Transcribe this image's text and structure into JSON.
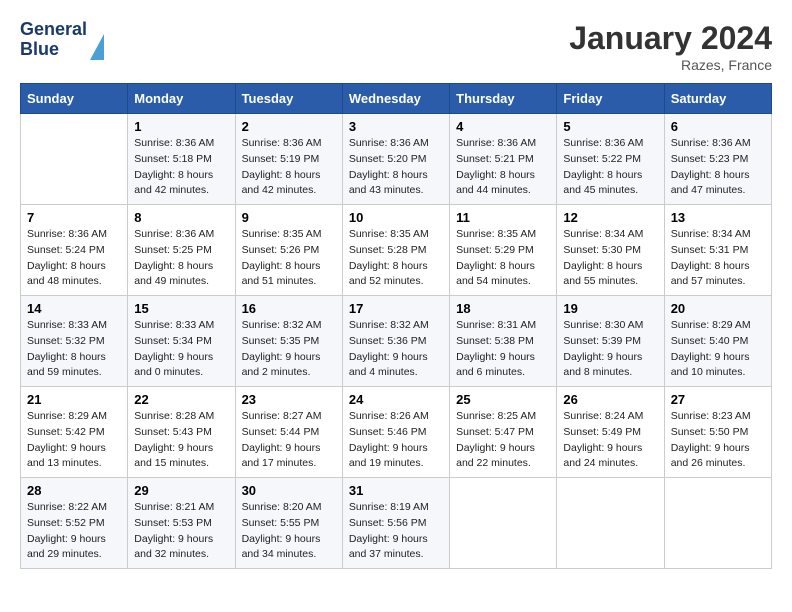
{
  "header": {
    "logo_line1": "General",
    "logo_line2": "Blue",
    "title": "January 2024",
    "subtitle": "Razes, France"
  },
  "days_header": [
    "Sunday",
    "Monday",
    "Tuesday",
    "Wednesday",
    "Thursday",
    "Friday",
    "Saturday"
  ],
  "weeks": [
    [
      {
        "num": "",
        "sunrise": "",
        "sunset": "",
        "daylight": ""
      },
      {
        "num": "1",
        "sunrise": "Sunrise: 8:36 AM",
        "sunset": "Sunset: 5:18 PM",
        "daylight": "Daylight: 8 hours and 42 minutes."
      },
      {
        "num": "2",
        "sunrise": "Sunrise: 8:36 AM",
        "sunset": "Sunset: 5:19 PM",
        "daylight": "Daylight: 8 hours and 42 minutes."
      },
      {
        "num": "3",
        "sunrise": "Sunrise: 8:36 AM",
        "sunset": "Sunset: 5:20 PM",
        "daylight": "Daylight: 8 hours and 43 minutes."
      },
      {
        "num": "4",
        "sunrise": "Sunrise: 8:36 AM",
        "sunset": "Sunset: 5:21 PM",
        "daylight": "Daylight: 8 hours and 44 minutes."
      },
      {
        "num": "5",
        "sunrise": "Sunrise: 8:36 AM",
        "sunset": "Sunset: 5:22 PM",
        "daylight": "Daylight: 8 hours and 45 minutes."
      },
      {
        "num": "6",
        "sunrise": "Sunrise: 8:36 AM",
        "sunset": "Sunset: 5:23 PM",
        "daylight": "Daylight: 8 hours and 47 minutes."
      }
    ],
    [
      {
        "num": "7",
        "sunrise": "Sunrise: 8:36 AM",
        "sunset": "Sunset: 5:24 PM",
        "daylight": "Daylight: 8 hours and 48 minutes."
      },
      {
        "num": "8",
        "sunrise": "Sunrise: 8:36 AM",
        "sunset": "Sunset: 5:25 PM",
        "daylight": "Daylight: 8 hours and 49 minutes."
      },
      {
        "num": "9",
        "sunrise": "Sunrise: 8:35 AM",
        "sunset": "Sunset: 5:26 PM",
        "daylight": "Daylight: 8 hours and 51 minutes."
      },
      {
        "num": "10",
        "sunrise": "Sunrise: 8:35 AM",
        "sunset": "Sunset: 5:28 PM",
        "daylight": "Daylight: 8 hours and 52 minutes."
      },
      {
        "num": "11",
        "sunrise": "Sunrise: 8:35 AM",
        "sunset": "Sunset: 5:29 PM",
        "daylight": "Daylight: 8 hours and 54 minutes."
      },
      {
        "num": "12",
        "sunrise": "Sunrise: 8:34 AM",
        "sunset": "Sunset: 5:30 PM",
        "daylight": "Daylight: 8 hours and 55 minutes."
      },
      {
        "num": "13",
        "sunrise": "Sunrise: 8:34 AM",
        "sunset": "Sunset: 5:31 PM",
        "daylight": "Daylight: 8 hours and 57 minutes."
      }
    ],
    [
      {
        "num": "14",
        "sunrise": "Sunrise: 8:33 AM",
        "sunset": "Sunset: 5:32 PM",
        "daylight": "Daylight: 8 hours and 59 minutes."
      },
      {
        "num": "15",
        "sunrise": "Sunrise: 8:33 AM",
        "sunset": "Sunset: 5:34 PM",
        "daylight": "Daylight: 9 hours and 0 minutes."
      },
      {
        "num": "16",
        "sunrise": "Sunrise: 8:32 AM",
        "sunset": "Sunset: 5:35 PM",
        "daylight": "Daylight: 9 hours and 2 minutes."
      },
      {
        "num": "17",
        "sunrise": "Sunrise: 8:32 AM",
        "sunset": "Sunset: 5:36 PM",
        "daylight": "Daylight: 9 hours and 4 minutes."
      },
      {
        "num": "18",
        "sunrise": "Sunrise: 8:31 AM",
        "sunset": "Sunset: 5:38 PM",
        "daylight": "Daylight: 9 hours and 6 minutes."
      },
      {
        "num": "19",
        "sunrise": "Sunrise: 8:30 AM",
        "sunset": "Sunset: 5:39 PM",
        "daylight": "Daylight: 9 hours and 8 minutes."
      },
      {
        "num": "20",
        "sunrise": "Sunrise: 8:29 AM",
        "sunset": "Sunset: 5:40 PM",
        "daylight": "Daylight: 9 hours and 10 minutes."
      }
    ],
    [
      {
        "num": "21",
        "sunrise": "Sunrise: 8:29 AM",
        "sunset": "Sunset: 5:42 PM",
        "daylight": "Daylight: 9 hours and 13 minutes."
      },
      {
        "num": "22",
        "sunrise": "Sunrise: 8:28 AM",
        "sunset": "Sunset: 5:43 PM",
        "daylight": "Daylight: 9 hours and 15 minutes."
      },
      {
        "num": "23",
        "sunrise": "Sunrise: 8:27 AM",
        "sunset": "Sunset: 5:44 PM",
        "daylight": "Daylight: 9 hours and 17 minutes."
      },
      {
        "num": "24",
        "sunrise": "Sunrise: 8:26 AM",
        "sunset": "Sunset: 5:46 PM",
        "daylight": "Daylight: 9 hours and 19 minutes."
      },
      {
        "num": "25",
        "sunrise": "Sunrise: 8:25 AM",
        "sunset": "Sunset: 5:47 PM",
        "daylight": "Daylight: 9 hours and 22 minutes."
      },
      {
        "num": "26",
        "sunrise": "Sunrise: 8:24 AM",
        "sunset": "Sunset: 5:49 PM",
        "daylight": "Daylight: 9 hours and 24 minutes."
      },
      {
        "num": "27",
        "sunrise": "Sunrise: 8:23 AM",
        "sunset": "Sunset: 5:50 PM",
        "daylight": "Daylight: 9 hours and 26 minutes."
      }
    ],
    [
      {
        "num": "28",
        "sunrise": "Sunrise: 8:22 AM",
        "sunset": "Sunset: 5:52 PM",
        "daylight": "Daylight: 9 hours and 29 minutes."
      },
      {
        "num": "29",
        "sunrise": "Sunrise: 8:21 AM",
        "sunset": "Sunset: 5:53 PM",
        "daylight": "Daylight: 9 hours and 32 minutes."
      },
      {
        "num": "30",
        "sunrise": "Sunrise: 8:20 AM",
        "sunset": "Sunset: 5:55 PM",
        "daylight": "Daylight: 9 hours and 34 minutes."
      },
      {
        "num": "31",
        "sunrise": "Sunrise: 8:19 AM",
        "sunset": "Sunset: 5:56 PM",
        "daylight": "Daylight: 9 hours and 37 minutes."
      },
      {
        "num": "",
        "sunrise": "",
        "sunset": "",
        "daylight": ""
      },
      {
        "num": "",
        "sunrise": "",
        "sunset": "",
        "daylight": ""
      },
      {
        "num": "",
        "sunrise": "",
        "sunset": "",
        "daylight": ""
      }
    ]
  ]
}
